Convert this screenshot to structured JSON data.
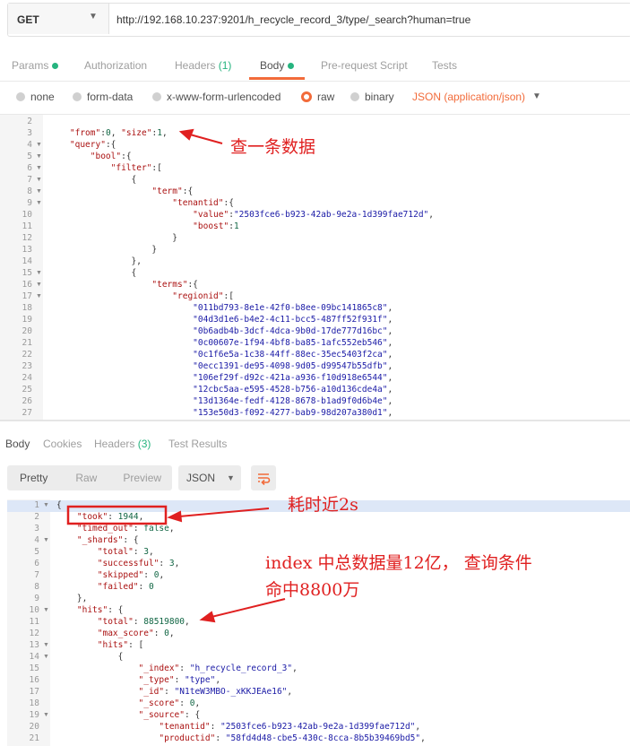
{
  "request": {
    "method": "GET",
    "url": "http://192.168.10.237:9201/h_recycle_record_3/type/_search?human=true"
  },
  "request_tabs": [
    {
      "label": "Params",
      "dot": true
    },
    {
      "label": "Authorization"
    },
    {
      "label": "Headers",
      "count": "(1)"
    },
    {
      "label": "Body",
      "dot": true,
      "active": true
    },
    {
      "label": "Pre-request Script"
    },
    {
      "label": "Tests"
    }
  ],
  "body_options": {
    "none": "none",
    "form_data": "form-data",
    "urlencoded": "x-www-form-urlencoded",
    "raw": "raw",
    "binary": "binary",
    "content_type": "JSON (application/json)",
    "selected": "raw"
  },
  "request_code": [
    {
      "n": "2",
      "fold": false,
      "text": ""
    },
    {
      "n": "3",
      "fold": false,
      "text": "    \"from\":0, \"size\":1,"
    },
    {
      "n": "4",
      "fold": true,
      "text": "    \"query\":{"
    },
    {
      "n": "5",
      "fold": true,
      "text": "        \"bool\":{"
    },
    {
      "n": "6",
      "fold": true,
      "text": "            \"filter\":["
    },
    {
      "n": "7",
      "fold": true,
      "text": "                {"
    },
    {
      "n": "8",
      "fold": true,
      "text": "                    \"term\":{"
    },
    {
      "n": "9",
      "fold": true,
      "text": "                        \"tenantid\":{"
    },
    {
      "n": "10",
      "fold": false,
      "text": "                            \"value\":\"2503fce6-b923-42ab-9e2a-1d399fae712d\","
    },
    {
      "n": "11",
      "fold": false,
      "text": "                            \"boost\":1"
    },
    {
      "n": "12",
      "fold": false,
      "text": "                        }"
    },
    {
      "n": "13",
      "fold": false,
      "text": "                    }"
    },
    {
      "n": "14",
      "fold": false,
      "text": "                },"
    },
    {
      "n": "15",
      "fold": true,
      "text": "                {"
    },
    {
      "n": "16",
      "fold": true,
      "text": "                    \"terms\":{"
    },
    {
      "n": "17",
      "fold": true,
      "text": "                        \"regionid\":["
    },
    {
      "n": "18",
      "fold": false,
      "text": "                            \"011bd793-8e1e-42f0-b8ee-09bc141865c8\","
    },
    {
      "n": "19",
      "fold": false,
      "text": "                            \"04d3d1e6-b4e2-4c11-bcc5-487ff52f931f\","
    },
    {
      "n": "20",
      "fold": false,
      "text": "                            \"0b6adb4b-3dcf-4dca-9b0d-17de777d16bc\","
    },
    {
      "n": "21",
      "fold": false,
      "text": "                            \"0c00607e-1f94-4bf8-ba85-1afc552eb546\","
    },
    {
      "n": "22",
      "fold": false,
      "text": "                            \"0c1f6e5a-1c38-44ff-88ec-35ec5403f2ca\","
    },
    {
      "n": "23",
      "fold": false,
      "text": "                            \"0ecc1391-de95-4098-9d05-d99547b55dfb\","
    },
    {
      "n": "24",
      "fold": false,
      "text": "                            \"106ef29f-d92c-421a-a936-f10d918e6544\","
    },
    {
      "n": "25",
      "fold": false,
      "text": "                            \"12cbc5aa-e595-4528-b756-a10d136cde4a\","
    },
    {
      "n": "26",
      "fold": false,
      "text": "                            \"13d1364e-fedf-4128-8678-b1ad9f0d6b4e\","
    },
    {
      "n": "27",
      "fold": false,
      "text": "                            \"153e50d3-f092-4277-bab9-98d207a380d1\","
    }
  ],
  "response_tabs": [
    {
      "label": "Body",
      "active": true
    },
    {
      "label": "Cookies"
    },
    {
      "label": "Headers",
      "count": "(3)"
    },
    {
      "label": "Test Results"
    }
  ],
  "response_view": {
    "pretty": "Pretty",
    "raw": "Raw",
    "preview": "Preview",
    "format": "JSON"
  },
  "response_code": [
    {
      "n": "1",
      "fold": true,
      "text": "{"
    },
    {
      "n": "2",
      "fold": false,
      "text": "    \"took\": 1944,"
    },
    {
      "n": "3",
      "fold": false,
      "text": "    \"timed_out\": false,"
    },
    {
      "n": "4",
      "fold": true,
      "text": "    \"_shards\": {"
    },
    {
      "n": "5",
      "fold": false,
      "text": "        \"total\": 3,"
    },
    {
      "n": "6",
      "fold": false,
      "text": "        \"successful\": 3,"
    },
    {
      "n": "7",
      "fold": false,
      "text": "        \"skipped\": 0,"
    },
    {
      "n": "8",
      "fold": false,
      "text": "        \"failed\": 0"
    },
    {
      "n": "9",
      "fold": false,
      "text": "    },"
    },
    {
      "n": "10",
      "fold": true,
      "text": "    \"hits\": {"
    },
    {
      "n": "11",
      "fold": false,
      "text": "        \"total\": 88519800,"
    },
    {
      "n": "12",
      "fold": false,
      "text": "        \"max_score\": 0,"
    },
    {
      "n": "13",
      "fold": true,
      "text": "        \"hits\": ["
    },
    {
      "n": "14",
      "fold": true,
      "text": "            {"
    },
    {
      "n": "15",
      "fold": false,
      "text": "                \"_index\": \"h_recycle_record_3\","
    },
    {
      "n": "16",
      "fold": false,
      "text": "                \"_type\": \"type\","
    },
    {
      "n": "17",
      "fold": false,
      "text": "                \"_id\": \"N1teW3MBO-_xKKJEAe16\","
    },
    {
      "n": "18",
      "fold": false,
      "text": "                \"_score\": 0,"
    },
    {
      "n": "19",
      "fold": true,
      "text": "                \"_source\": {"
    },
    {
      "n": "20",
      "fold": false,
      "text": "                    \"tenantid\": \"2503fce6-b923-42ab-9e2a-1d399fae712d\","
    },
    {
      "n": "21",
      "fold": false,
      "text": "                    \"productid\": \"58fd4d48-cbe5-430c-8cca-8b5b39469bd5\","
    }
  ],
  "annotations": {
    "query_one": "查一条数据",
    "took_note": "耗时近2s",
    "total_line1": "index 中总数据量12亿， 查询条件",
    "total_line2": "命中8800万"
  },
  "colors": {
    "accent": "#f26b3a",
    "green": "#26b47f",
    "annotation": "#e02020"
  }
}
